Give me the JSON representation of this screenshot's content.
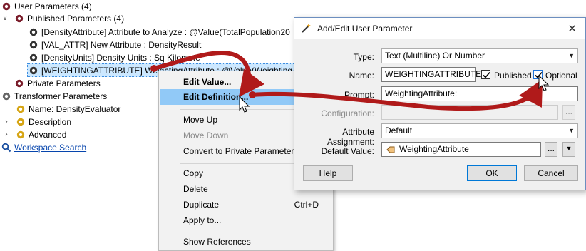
{
  "tree": {
    "user_parameters": "User Parameters (4)",
    "published_parameters": "Published Parameters (4)",
    "items": [
      "[DensityAttribute] Attribute to Analyze : @Value(TotalPopulation20",
      "[VAL_ATTR] New Attribute : DensityResult",
      "[DensityUnits] Density Units : Sq Kilomete",
      "[WEIGHTINGATTRIBUTE] WeightingAttribute : @Value(WeightingA"
    ],
    "private_parameters": "Private Parameters",
    "transformer_parameters": "Transformer Parameters",
    "name_item": "Name: DensityEvaluator",
    "description": "Description",
    "advanced": "Advanced",
    "workspace_search": "Workspace Search"
  },
  "context_menu": {
    "edit_value": "Edit Value...",
    "edit_definition": "Edit Definition...",
    "move_up": "Move Up",
    "move_down": "Move Down",
    "convert": "Convert to Private Parameter",
    "copy": "Copy",
    "delete": "Delete",
    "duplicate": "Duplicate",
    "duplicate_shortcut": "Ctrl+D",
    "apply_to": "Apply to...",
    "show_references": "Show References"
  },
  "dialog": {
    "title": "Add/Edit User Parameter",
    "type_label": "Type:",
    "type_value": "Text (Multiline) Or Number",
    "name_label": "Name:",
    "name_value": "WEIGHTINGATTRIBUTE",
    "published_label": "Published",
    "optional_label": "Optional",
    "prompt_label": "Prompt:",
    "prompt_value": "WeightingAttribute:",
    "configuration_label": "Configuration:",
    "configuration_button": "...",
    "attr_assign_label": "Attribute Assignment:",
    "attr_assign_value": "Default",
    "default_value_label": "Default Value:",
    "default_value": "WeightingAttribute",
    "default_more_button": "...",
    "help_button": "Help",
    "ok_button": "OK",
    "cancel_button": "Cancel",
    "close_glyph": "✕"
  },
  "colors": {
    "annotation_arrow": "#b01a1a",
    "menu_highlight": "#91c9f7",
    "tree_selection": "#cce8ff",
    "link": "#0645ad"
  }
}
